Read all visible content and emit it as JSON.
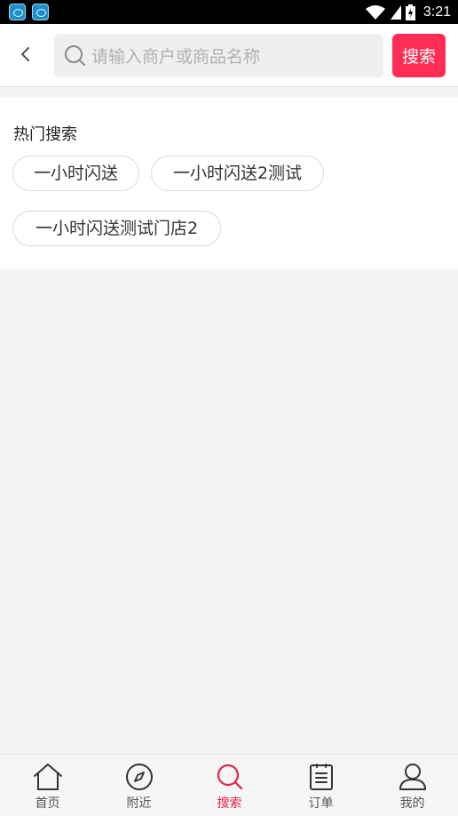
{
  "status_bar": {
    "time": "3:21"
  },
  "search": {
    "placeholder": "请输入商户或商品名称",
    "button_label": "搜索"
  },
  "hot_search": {
    "title": "热门搜索",
    "tags": [
      "一小时闪送",
      "一小时闪送2测试",
      "一小时闪送测试门店2"
    ]
  },
  "bottom_nav": {
    "active": "搜索",
    "accent_color": "#e8204f",
    "items": [
      {
        "label": "首页",
        "icon": "home-icon"
      },
      {
        "label": "附近",
        "icon": "compass-icon"
      },
      {
        "label": "搜索",
        "icon": "search-icon"
      },
      {
        "label": "订单",
        "icon": "order-list-icon"
      },
      {
        "label": "我的",
        "icon": "user-icon"
      }
    ]
  },
  "colors": {
    "brand": "#ff2d55",
    "background": "#f4f4f4"
  }
}
